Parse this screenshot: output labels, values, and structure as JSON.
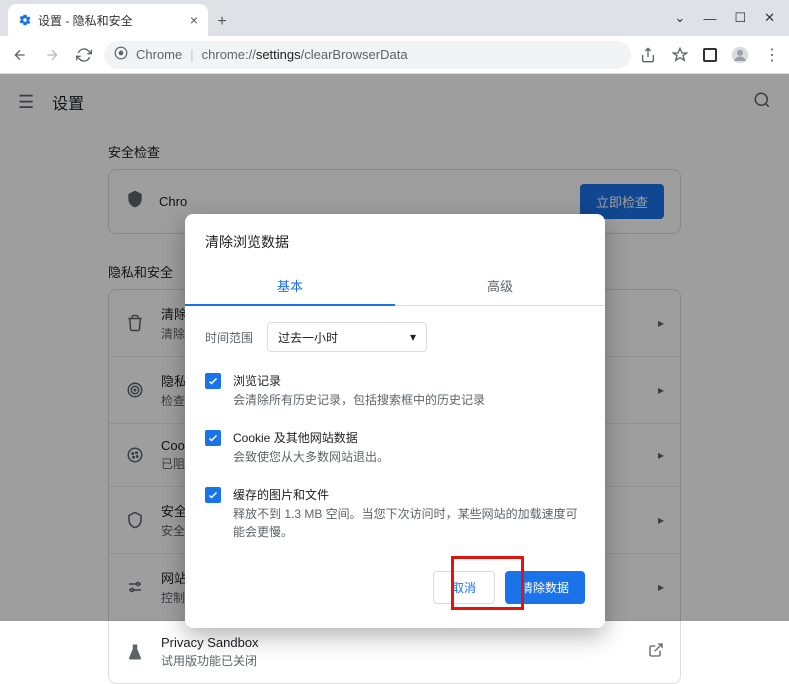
{
  "browser": {
    "tab_title": "设置 - 隐私和安全",
    "url_scheme": "Chrome",
    "url_host": "chrome://",
    "url_bold": "settings",
    "url_rest": "/clearBrowserData"
  },
  "page": {
    "title": "设置",
    "security_check_heading": "安全检查",
    "check_card_text": "Chro",
    "check_now_btn": "立即检查",
    "privacy_heading": "隐私和安全",
    "rows": [
      {
        "icon": "trash",
        "title": "清除",
        "sub": "清除"
      },
      {
        "icon": "target",
        "title": "隐私",
        "sub": "检查"
      },
      {
        "icon": "cookie",
        "title": "Cook",
        "sub": "已阻"
      },
      {
        "icon": "shield",
        "title": "安全",
        "sub": "安全"
      },
      {
        "icon": "tune",
        "title": "网站",
        "sub": "控制"
      },
      {
        "icon": "flask",
        "title": "Privacy Sandbox",
        "sub": "试用版功能已关闭"
      }
    ]
  },
  "dialog": {
    "title": "清除浏览数据",
    "tab_basic": "基本",
    "tab_advanced": "高级",
    "range_label": "时间范围",
    "range_value": "过去一小时",
    "items": [
      {
        "title": "浏览记录",
        "sub": "会清除所有历史记录，包括搜索框中的历史记录"
      },
      {
        "title": "Cookie 及其他网站数据",
        "sub": "会致使您从大多数网站退出。"
      },
      {
        "title": "缓存的图片和文件",
        "sub": "释放不到 1.3 MB 空间。当您下次访问时，某些网站的加载速度可能会更慢。"
      }
    ],
    "cancel": "取消",
    "confirm": "清除数据"
  }
}
